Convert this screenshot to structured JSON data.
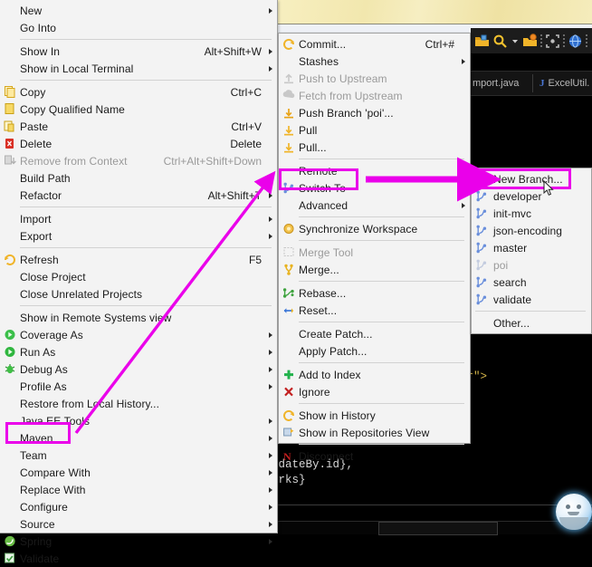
{
  "app": {
    "title": "Eclipse IDE context menu - Team > Switch To > New Branch",
    "accent_highlight": "#ea00ea",
    "menu_bg": "#f3f3f3"
  },
  "editor": {
    "tabs": [
      {
        "label": "mport.java",
        "marker": ""
      },
      {
        "label": "ExcelUtil.",
        "marker": "J"
      }
    ],
    "toolbar_icons": [
      "open-folder-icon",
      "search-icon",
      "chevron-down-icon",
      "open-folder-badge-icon",
      "focus-frame-icon",
      "globe-icon",
      "note-icon"
    ],
    "code_fragments": [
      "er\">",
      "pdateBy.id},",
      "arks}"
    ]
  },
  "context_menu": {
    "name": "project-context-menu",
    "items": [
      {
        "label": "New",
        "accel": "",
        "submenu": true,
        "icon": "",
        "disabled": false
      },
      {
        "label": "Go Into",
        "accel": "",
        "submenu": false,
        "icon": "",
        "disabled": false
      },
      {
        "separator": true
      },
      {
        "label": "Show In",
        "accel": "Alt+Shift+W",
        "submenu": true,
        "icon": "",
        "disabled": false
      },
      {
        "label": "Show in Local Terminal",
        "accel": "",
        "submenu": true,
        "icon": "",
        "disabled": false
      },
      {
        "separator": true
      },
      {
        "label": "Copy",
        "accel": "Ctrl+C",
        "submenu": false,
        "icon": "copy-icon",
        "disabled": false
      },
      {
        "label": "Copy Qualified Name",
        "accel": "",
        "submenu": false,
        "icon": "copy-qualified-icon",
        "disabled": false
      },
      {
        "label": "Paste",
        "accel": "Ctrl+V",
        "submenu": false,
        "icon": "paste-icon",
        "disabled": false
      },
      {
        "label": "Delete",
        "accel": "Delete",
        "submenu": false,
        "icon": "delete-icon",
        "disabled": false
      },
      {
        "label": "Remove from Context",
        "accel": "Ctrl+Alt+Shift+Down",
        "submenu": false,
        "icon": "remove-context-icon",
        "disabled": true
      },
      {
        "label": "Build Path",
        "accel": "",
        "submenu": true,
        "icon": "",
        "disabled": false
      },
      {
        "label": "Refactor",
        "accel": "Alt+Shift+T",
        "submenu": true,
        "icon": "",
        "disabled": false
      },
      {
        "separator": true
      },
      {
        "label": "Import",
        "accel": "",
        "submenu": true,
        "icon": "",
        "disabled": false
      },
      {
        "label": "Export",
        "accel": "",
        "submenu": true,
        "icon": "",
        "disabled": false
      },
      {
        "separator": true
      },
      {
        "label": "Refresh",
        "accel": "F5",
        "submenu": false,
        "icon": "refresh-icon",
        "disabled": false
      },
      {
        "label": "Close Project",
        "accel": "",
        "submenu": false,
        "icon": "",
        "disabled": false
      },
      {
        "label": "Close Unrelated Projects",
        "accel": "",
        "submenu": false,
        "icon": "",
        "disabled": false
      },
      {
        "separator": true
      },
      {
        "label": "Show in Remote Systems view",
        "accel": "",
        "submenu": false,
        "icon": "",
        "disabled": false
      },
      {
        "label": "Coverage As",
        "accel": "",
        "submenu": true,
        "icon": "coverage-icon",
        "disabled": false
      },
      {
        "label": "Run As",
        "accel": "",
        "submenu": true,
        "icon": "run-icon",
        "disabled": false
      },
      {
        "label": "Debug As",
        "accel": "",
        "submenu": true,
        "icon": "debug-icon",
        "disabled": false
      },
      {
        "label": "Profile As",
        "accel": "",
        "submenu": true,
        "icon": "",
        "disabled": false
      },
      {
        "label": "Restore from Local History...",
        "accel": "",
        "submenu": false,
        "icon": "",
        "disabled": false
      },
      {
        "label": "Java EE Tools",
        "accel": "",
        "submenu": true,
        "icon": "",
        "disabled": false
      },
      {
        "label": "Maven",
        "accel": "",
        "submenu": true,
        "icon": "",
        "disabled": false
      },
      {
        "label": "Team",
        "accel": "",
        "submenu": true,
        "icon": "",
        "disabled": false,
        "highlighted": true
      },
      {
        "label": "Compare With",
        "accel": "",
        "submenu": true,
        "icon": "",
        "disabled": false
      },
      {
        "label": "Replace With",
        "accel": "",
        "submenu": true,
        "icon": "",
        "disabled": false
      },
      {
        "label": "Configure",
        "accel": "",
        "submenu": true,
        "icon": "",
        "disabled": false
      },
      {
        "label": "Source",
        "accel": "",
        "submenu": true,
        "icon": "",
        "disabled": false
      },
      {
        "label": "Spring",
        "accel": "",
        "submenu": true,
        "icon": "spring-icon",
        "disabled": false
      },
      {
        "label": "Validate",
        "accel": "",
        "submenu": false,
        "icon": "validate-icon",
        "disabled": false
      }
    ]
  },
  "team_menu": {
    "name": "team-git-submenu",
    "items": [
      {
        "label": "Commit...",
        "accel": "Ctrl+#",
        "submenu": false,
        "icon": "commit-icon",
        "disabled": false
      },
      {
        "label": "Stashes",
        "accel": "",
        "submenu": true,
        "icon": "",
        "disabled": false
      },
      {
        "label": "Push to Upstream",
        "accel": "",
        "submenu": false,
        "icon": "push-upstream-icon",
        "disabled": true
      },
      {
        "label": "Fetch from Upstream",
        "accel": "",
        "submenu": false,
        "icon": "fetch-upstream-icon",
        "disabled": true
      },
      {
        "label": "Push Branch 'poi'...",
        "accel": "",
        "submenu": false,
        "icon": "push-branch-icon",
        "disabled": false
      },
      {
        "label": "Pull",
        "accel": "",
        "submenu": false,
        "icon": "pull-icon",
        "disabled": false
      },
      {
        "label": "Pull...",
        "accel": "",
        "submenu": false,
        "icon": "pull-dialog-icon",
        "disabled": false
      },
      {
        "separator": true
      },
      {
        "label": "Remote",
        "accel": "",
        "submenu": true,
        "icon": "",
        "disabled": false
      },
      {
        "label": "Switch To",
        "accel": "",
        "submenu": true,
        "icon": "branch-icon",
        "disabled": false,
        "highlighted": true
      },
      {
        "label": "Advanced",
        "accel": "",
        "submenu": true,
        "icon": "",
        "disabled": false
      },
      {
        "separator": true
      },
      {
        "label": "Synchronize Workspace",
        "accel": "",
        "submenu": false,
        "icon": "synchronize-icon",
        "disabled": false
      },
      {
        "separator": true
      },
      {
        "label": "Merge Tool",
        "accel": "",
        "submenu": false,
        "icon": "merge-tool-icon",
        "disabled": true
      },
      {
        "label": "Merge...",
        "accel": "",
        "submenu": false,
        "icon": "merge-icon",
        "disabled": false
      },
      {
        "separator": true
      },
      {
        "label": "Rebase...",
        "accel": "",
        "submenu": false,
        "icon": "rebase-icon",
        "disabled": false
      },
      {
        "label": "Reset...",
        "accel": "",
        "submenu": false,
        "icon": "reset-icon",
        "disabled": false
      },
      {
        "separator": true
      },
      {
        "label": "Create Patch...",
        "accel": "",
        "submenu": false,
        "icon": "",
        "disabled": false
      },
      {
        "label": "Apply Patch...",
        "accel": "",
        "submenu": false,
        "icon": "",
        "disabled": false
      },
      {
        "separator": true
      },
      {
        "label": "Add to Index",
        "accel": "",
        "submenu": false,
        "icon": "add-index-icon",
        "disabled": false
      },
      {
        "label": "Ignore",
        "accel": "",
        "submenu": false,
        "icon": "ignore-icon",
        "disabled": false
      },
      {
        "separator": true
      },
      {
        "label": "Show in History",
        "accel": "",
        "submenu": false,
        "icon": "history-icon",
        "disabled": false
      },
      {
        "label": "Show in Repositories View",
        "accel": "",
        "submenu": false,
        "icon": "repositories-icon",
        "disabled": false
      },
      {
        "separator": true
      },
      {
        "label": "Disconnect",
        "accel": "",
        "submenu": false,
        "icon": "disconnect-icon",
        "disabled": false
      }
    ]
  },
  "switch_to_menu": {
    "name": "switch-to-submenu",
    "items": [
      {
        "label": "New Branch...",
        "icon": "new-branch-icon",
        "disabled": false,
        "highlighted": true
      },
      {
        "label": "developer",
        "icon": "branch-icon",
        "disabled": false
      },
      {
        "label": "init-mvc",
        "icon": "branch-icon",
        "disabled": false
      },
      {
        "label": "json-encoding",
        "icon": "branch-icon",
        "disabled": false
      },
      {
        "label": "master",
        "icon": "branch-icon",
        "disabled": false
      },
      {
        "label": "poi",
        "icon": "branch-icon",
        "disabled": true
      },
      {
        "label": "search",
        "icon": "branch-icon",
        "disabled": false
      },
      {
        "label": "validate",
        "icon": "branch-icon",
        "disabled": false
      },
      {
        "separator": true
      },
      {
        "label": "Other...",
        "icon": "",
        "disabled": false
      }
    ]
  },
  "annotations": {
    "arrow_color": "#ea00ea",
    "boxes": [
      "Team",
      "Switch To",
      "New Branch..."
    ]
  }
}
